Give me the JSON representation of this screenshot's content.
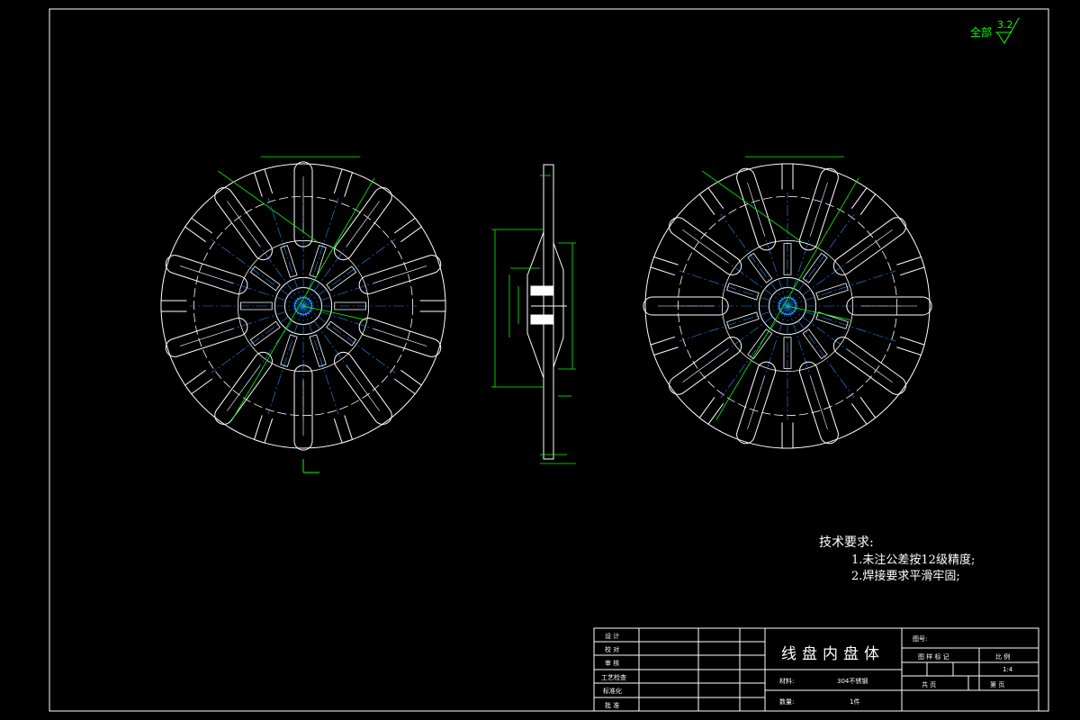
{
  "drawing": {
    "part_title": "线盘内盘体",
    "surface_finish": {
      "label": "全部",
      "value": "3.2"
    },
    "technical_requirements": {
      "heading": "技术要求:",
      "items": [
        "1.未注公差按12级精度;",
        "2.焊接要求平滑牢固;"
      ]
    },
    "title_block": {
      "left_rows": [
        "设 计",
        "校 对",
        "审 核",
        "工艺检查",
        "标准化",
        "批 准"
      ],
      "drawing_no_label": "图号:",
      "material_label": "材料:",
      "material_value": "304不锈钢",
      "quantity_label": "数量:",
      "quantity_value": "1件",
      "header_cells": [
        "图 样 标 记",
        "比 例"
      ],
      "scale_value": "1:4",
      "sheet_cells": [
        "共 页",
        "第 页"
      ]
    }
  },
  "colors": {
    "background": "#000000",
    "lines": "#ffffff",
    "dimensions": "#00ff00",
    "centerlines": "#1e90ff"
  }
}
